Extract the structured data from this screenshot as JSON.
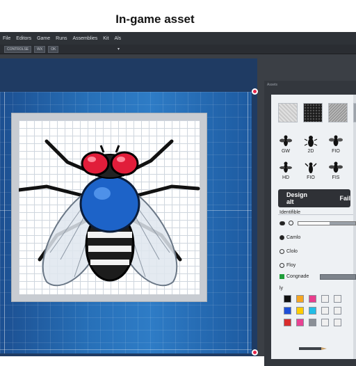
{
  "banner": {
    "title": "In-game asset"
  },
  "menubar": {
    "items": [
      "File",
      "Editors",
      "Game",
      "Runs",
      "Assemblies",
      "Kit",
      "Als"
    ]
  },
  "toolbar": {
    "chip1": "CONTROLSE",
    "chip2": "WX",
    "chip3": "OK",
    "dropdown": "▾"
  },
  "panel": {
    "header": "Assets",
    "icon_labels": [
      "GW",
      "2D",
      "FIO",
      "HD",
      "FIO",
      "FIS"
    ],
    "design_button": {
      "label1": "Design alt",
      "label2": "Fail"
    },
    "identifiable_label": "Identifible",
    "slider_value": 0.55,
    "options": [
      "Camlo",
      "Clolo",
      "Floy"
    ],
    "selected_option": 0,
    "congrade_label": "Congnade",
    "ly_label": "ly",
    "swatch_colors": [
      "#111111",
      "#f5a623",
      "#e83e8c",
      "#f0f0f0",
      "#f0f0f0",
      "#1e4fd8",
      "#ffcc00",
      "#22bde6",
      "#f0f0f0",
      "#f0f0f0",
      "#d92d2d",
      "#e84393",
      "#8a8f96",
      "#f0f0f0",
      "#f0f0f0"
    ],
    "colors": {
      "panel_bg": "#eef1f4",
      "button_bg": "#2f3136"
    }
  },
  "canvas": {
    "asset_subject": "fly-sprite",
    "accent": "#e8254a"
  }
}
